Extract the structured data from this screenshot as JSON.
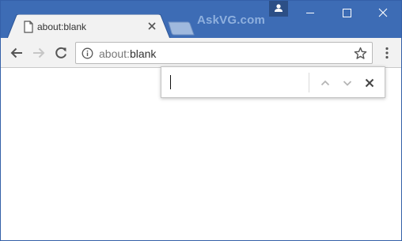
{
  "tab": {
    "title": "about:blank"
  },
  "brand": {
    "text": "AskVG.com"
  },
  "omnibox": {
    "scheme": "about:",
    "rest": "blank"
  },
  "findbar": {
    "value": ""
  },
  "icons": {
    "tab": "page-icon",
    "tab_close": "close-icon",
    "back": "arrow-left-icon",
    "forward": "arrow-right-icon",
    "reload": "reload-icon",
    "info": "info-icon",
    "star": "star-icon",
    "menu": "kebab-menu-icon",
    "profile": "person-icon",
    "find_prev": "chevron-up-icon",
    "find_next": "chevron-down-icon",
    "find_close": "close-icon"
  },
  "colors": {
    "frame": "#3d6cb5",
    "toolbar": "#f2f2f2",
    "tab_active": "#f2f2f2",
    "content": "#ffffff"
  }
}
